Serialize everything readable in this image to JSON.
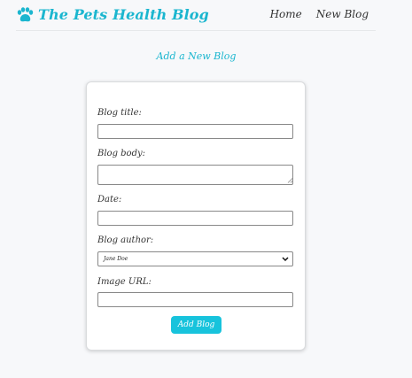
{
  "brand": {
    "title": "The Pets Health Blog",
    "icon": "paw-icon",
    "color": "#1bb6cf"
  },
  "nav": {
    "home_label": "Home",
    "new_blog_label": "New Blog"
  },
  "page": {
    "heading": "Add a New Blog"
  },
  "form": {
    "title_label": "Blog title:",
    "title_value": "",
    "body_label": "Blog body:",
    "body_value": "",
    "date_label": "Date:",
    "date_value": "",
    "author_label": "Blog author:",
    "author_selected": "Jane Doe",
    "image_label": "Image URL:",
    "image_value": "",
    "submit_label": "Add Blog",
    "submit_color": "#17c3dc"
  }
}
